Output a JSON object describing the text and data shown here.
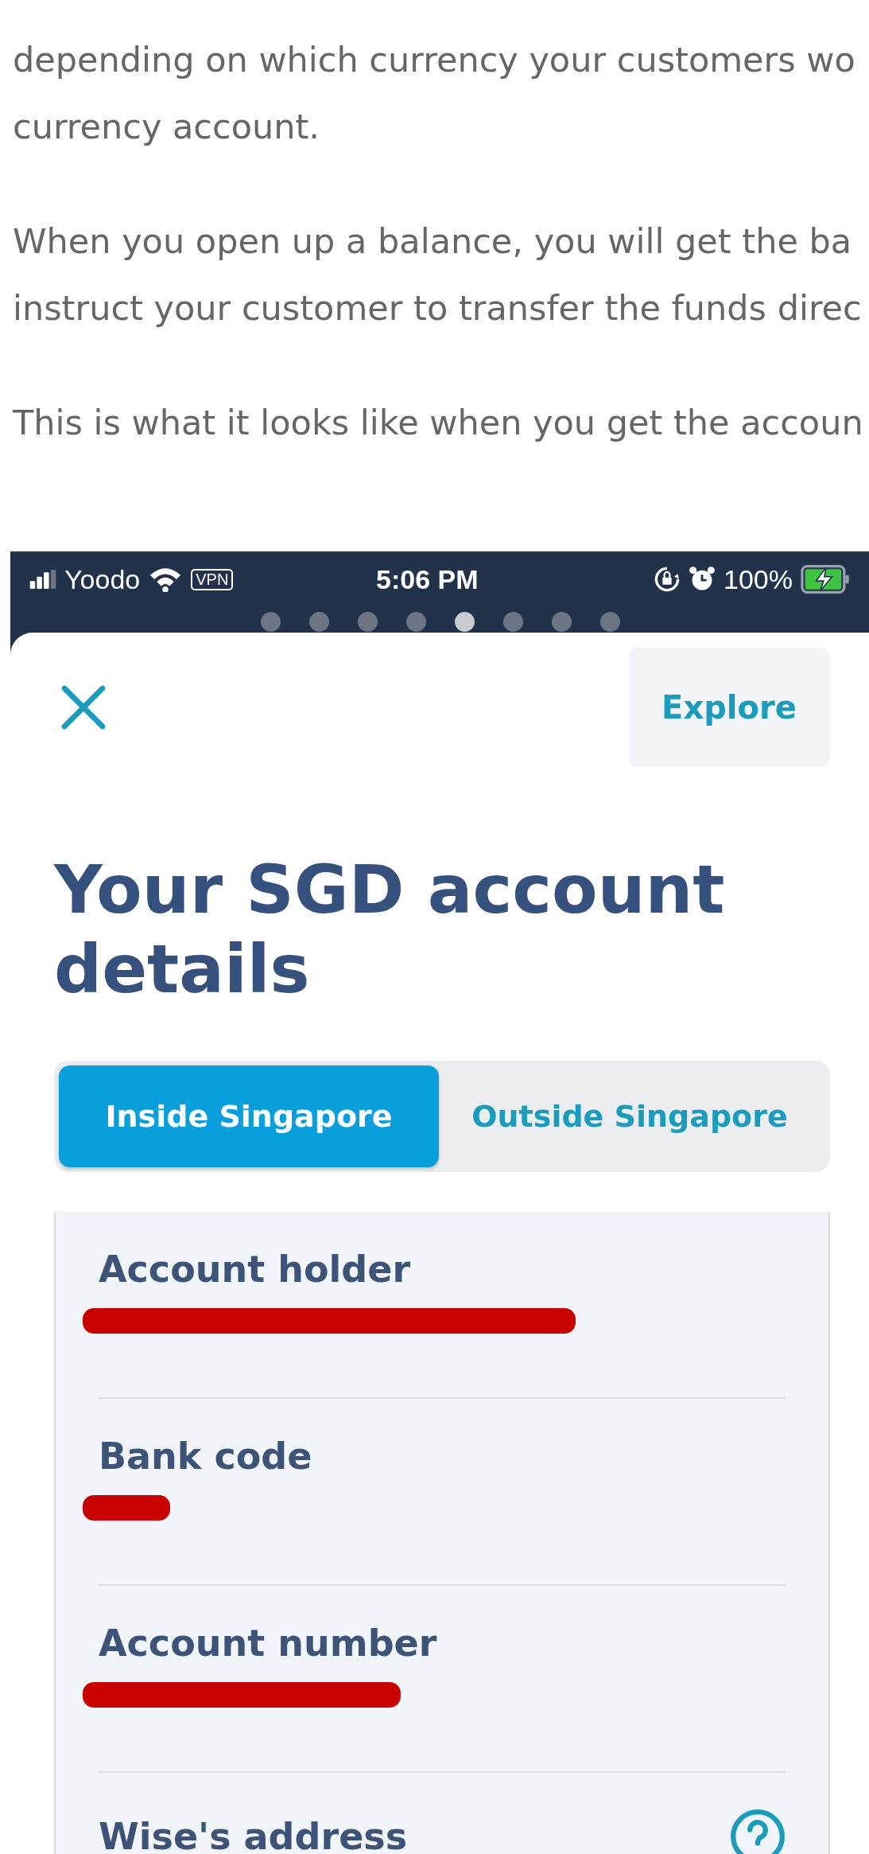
{
  "article": {
    "paragraphs": [
      {
        "lines": [
          "depending on which currency your customers wo",
          "currency account."
        ]
      },
      {
        "lines": [
          "When you open up a balance, you will get the ba",
          "instruct your customer to transfer the funds direc"
        ]
      },
      {
        "lines": [
          "This is what it looks like when you get the accoun"
        ]
      }
    ]
  },
  "phone": {
    "status_bar": {
      "carrier": "Yoodo",
      "vpn": "VPN",
      "time": "5:06 PM",
      "battery": "100%"
    },
    "page_dots": [
      {
        "selected": false
      },
      {
        "selected": false
      },
      {
        "selected": false
      },
      {
        "selected": false
      },
      {
        "selected": true
      },
      {
        "selected": false
      },
      {
        "selected": false
      },
      {
        "selected": false
      }
    ],
    "explore_button": "Explore",
    "title": "Your SGD account details",
    "tabs": [
      {
        "label": "Inside Singapore",
        "selected": true
      },
      {
        "label": "Outside Singapore",
        "selected": false
      }
    ],
    "fields": [
      {
        "label": "Account holder",
        "kind": "redacted"
      },
      {
        "label": "Bank code",
        "kind": "redacted"
      },
      {
        "label": "Account number",
        "kind": "redacted"
      },
      {
        "label": "Wise's address",
        "kind": "help"
      }
    ]
  }
}
